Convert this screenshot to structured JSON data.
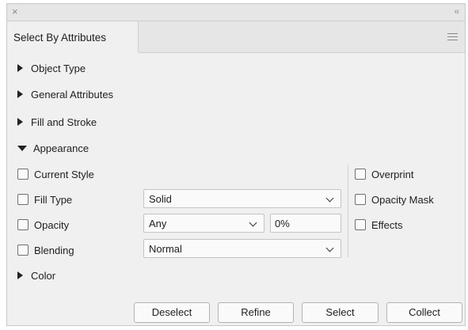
{
  "window": {
    "close_glyph": "×",
    "collapse_glyph": "‹‹"
  },
  "tab": {
    "label": "Select By Attributes"
  },
  "sections": {
    "object_type": "Object Type",
    "general_attributes": "General Attributes",
    "fill_and_stroke": "Fill and Stroke",
    "appearance": "Appearance",
    "color": "Color"
  },
  "appearance": {
    "current_style": {
      "label": "Current Style",
      "checked": false
    },
    "fill_type": {
      "label": "Fill Type",
      "checked": false,
      "value": "Solid"
    },
    "opacity": {
      "label": "Opacity",
      "checked": false,
      "value": "Any",
      "percent": "0%"
    },
    "blending": {
      "label": "Blending",
      "checked": false,
      "value": "Normal"
    },
    "overprint": {
      "label": "Overprint",
      "checked": false
    },
    "opacity_mask": {
      "label": "Opacity Mask",
      "checked": false
    },
    "effects": {
      "label": "Effects",
      "checked": false
    }
  },
  "buttons": {
    "deselect": "Deselect",
    "refine": "Refine",
    "select": "Select",
    "collect": "Collect"
  },
  "icons": [
    "close-icon",
    "collapse-icon",
    "panel-menu-icon",
    "disclosure-triangle-icon",
    "chevron-down-icon"
  ]
}
